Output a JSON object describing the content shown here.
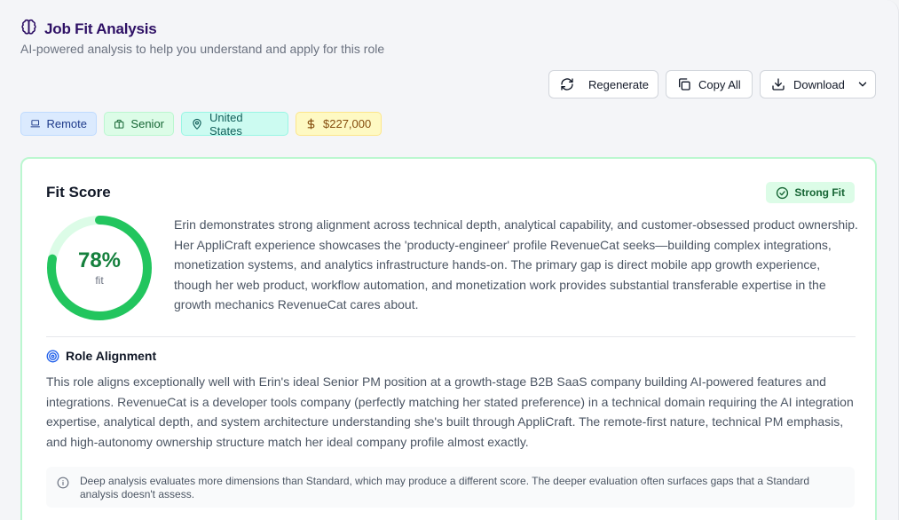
{
  "header": {
    "title": "Job Fit Analysis",
    "subtitle": "AI-powered analysis to help you understand and apply for this role",
    "icon": "brain-icon",
    "accent_color": "#2e1065"
  },
  "actions": {
    "regenerate_label": "Regenerate",
    "copy_label": "Copy All",
    "download_label": "Download"
  },
  "tags": [
    {
      "label": "Remote",
      "icon": "laptop-icon"
    },
    {
      "label": "Senior",
      "icon": "briefcase-icon"
    },
    {
      "label": "United States",
      "icon": "map-pin-icon"
    },
    {
      "label": "$227,000",
      "icon": "dollar-icon"
    }
  ],
  "fit": {
    "title": "Fit Score",
    "badge": "Strong Fit",
    "score": 78,
    "score_text": "78%",
    "score_sub": "fit",
    "color": "#22c55e",
    "track_color": "#dcfce7",
    "summary": "Erin demonstrates strong alignment across technical depth, analytical capability, and customer-obsessed product ownership. Her AppliCraft experience showcases the 'producty-engineer' profile RevenueCat seeks—building complex integrations, monetization systems, and analytics infrastructure hands-on. The primary gap is direct mobile app growth experience, though her web product, workflow automation, and monetization work provides substantial transferable expertise in the growth mechanics RevenueCat cares about."
  },
  "role": {
    "title": "Role Alignment",
    "text": "This role aligns exceptionally well with Erin's ideal Senior PM position at a growth-stage B2B SaaS company building AI-powered features and integrations. RevenueCat is a developer tools company (perfectly matching her stated preference) in a technical domain requiring the AI integration expertise, analytical depth, and system architecture understanding she's built through AppliCraft. The remote-first nature, technical PM emphasis, and high-autonomy ownership structure match her ideal company profile almost exactly."
  },
  "note": {
    "text": "Deep analysis evaluates more dimensions than Standard, which may produce a different score. The deeper evaluation often surfaces gaps that a Standard analysis doesn't assess."
  }
}
